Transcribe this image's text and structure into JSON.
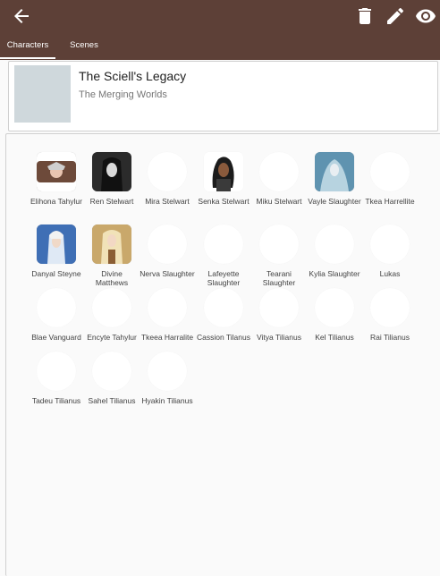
{
  "appbar": {
    "icons": [
      "back-arrow-icon",
      "trash-icon",
      "pencil-icon",
      "eye-icon"
    ],
    "color": "#5d4037"
  },
  "tabs": [
    {
      "label": "Characters",
      "active": true
    },
    {
      "label": "Scenes",
      "active": false
    }
  ],
  "story": {
    "title": "The Sciell's Legacy",
    "subtitle": "The Merging Worlds"
  },
  "characters": [
    {
      "name": "Elihona Tahylur",
      "has_image": true
    },
    {
      "name": "Ren Stelwart",
      "has_image": true
    },
    {
      "name": "Mira Stelwart",
      "has_image": false
    },
    {
      "name": "Senka Stelwart",
      "has_image": true
    },
    {
      "name": "Miku Stelwart",
      "has_image": false
    },
    {
      "name": "Vayle Slaughter",
      "has_image": true
    },
    {
      "name": "Tkea Harrellite",
      "has_image": false
    },
    {
      "name": "Danyal Steyne",
      "has_image": true
    },
    {
      "name": "Divine Matthews",
      "has_image": true
    },
    {
      "name": "Nerva Slaughter",
      "has_image": false
    },
    {
      "name": "Lafeyette Slaughter",
      "has_image": false
    },
    {
      "name": "Tearani Slaughter",
      "has_image": false
    },
    {
      "name": "Kylia Slaughter",
      "has_image": false
    },
    {
      "name": "Lukas",
      "has_image": false
    },
    {
      "name": "Blae Vanguard",
      "has_image": false
    },
    {
      "name": "Encyte Tahylur",
      "has_image": false
    },
    {
      "name": "Tkeea Harralite",
      "has_image": false
    },
    {
      "name": "Cassion Tilanus",
      "has_image": false
    },
    {
      "name": "Vitya Tilianus",
      "has_image": false
    },
    {
      "name": "Kel Tilianus",
      "has_image": false
    },
    {
      "name": "Rai Tilianus",
      "has_image": false
    },
    {
      "name": "Tadeu Tilianus",
      "has_image": false
    },
    {
      "name": "Sahel Tilianus",
      "has_image": false
    },
    {
      "name": "Hyakin Tilianus",
      "has_image": false
    }
  ]
}
